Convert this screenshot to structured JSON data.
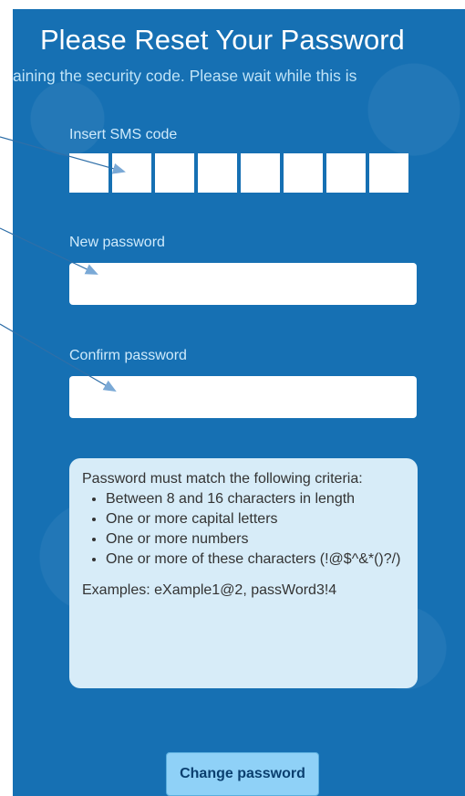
{
  "page": {
    "title": "Please Reset Your Password",
    "subtitle": "aining the security code. Please wait while this is"
  },
  "form": {
    "sms_label": "Insert SMS code",
    "sms_digits": [
      "",
      "",
      "",
      "",
      "",
      "",
      "",
      ""
    ],
    "new_password_label": "New password",
    "new_password_value": "",
    "confirm_password_label": "Confirm password",
    "confirm_password_value": ""
  },
  "criteria": {
    "intro": "Password must match the following criteria:",
    "items": [
      "Between 8 and 16 characters in length",
      "One or more capital letters",
      "One or more numbers",
      "One or more of these characters (!@$^&*()?/)"
    ],
    "examples": "Examples: eXample1@2, passWord3!4"
  },
  "actions": {
    "submit_label": "Change password"
  },
  "colors": {
    "panel_background": "#1670b3",
    "label_text": "#cfeafb",
    "criteria_background": "#d7ecf8",
    "button_background": "#8fd1f7",
    "callout_line": "#2f6fa8"
  }
}
